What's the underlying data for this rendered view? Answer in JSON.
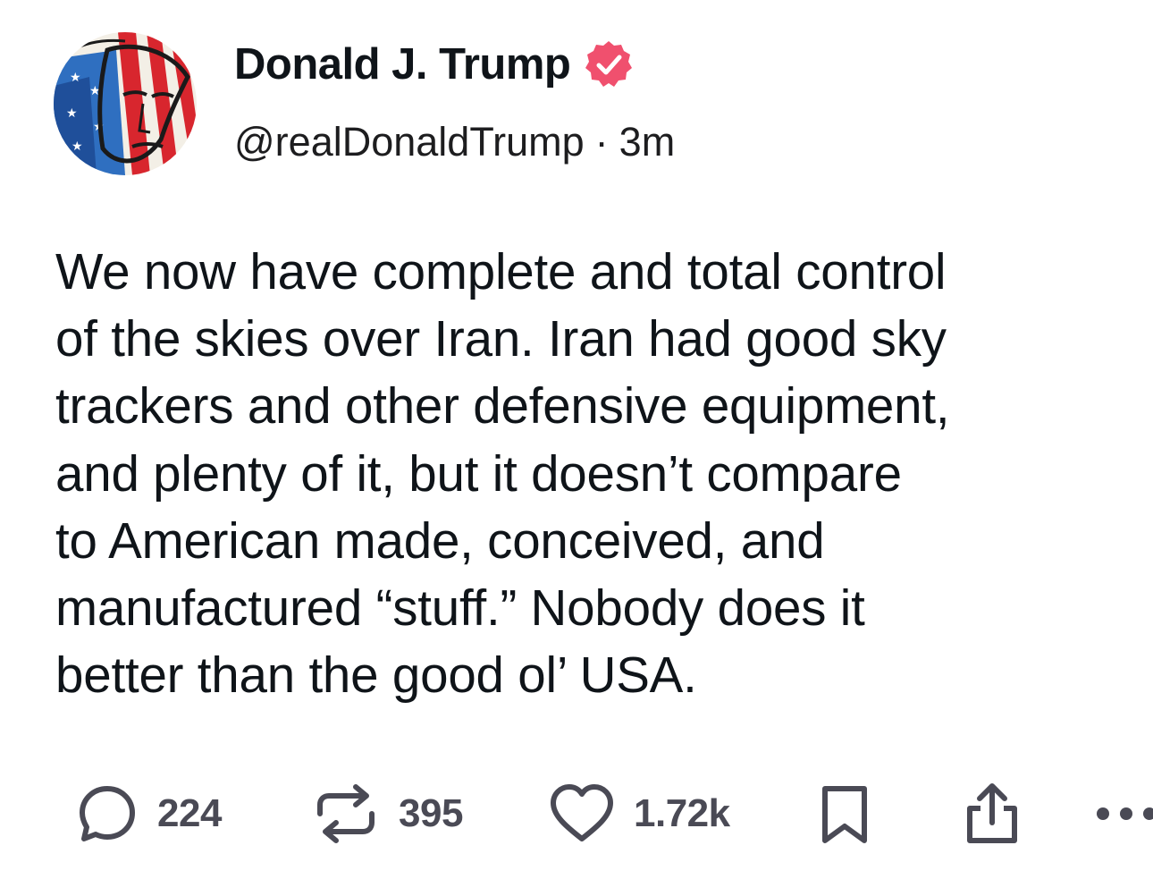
{
  "author": {
    "display_name": "Donald J. Trump",
    "handle": "@realDonaldTrump",
    "separator": "·",
    "timestamp": "3m",
    "verified_color": "#f0506e"
  },
  "post": {
    "text": "We now have complete and total control\nof the skies over Iran. Iran had good sky\ntrackers and other defensive equipment,\nand plenty of it, but it doesn’t compare\nto American made, conceived, and\nmanufactured “stuff.”  Nobody does it\nbetter than the good ol’ USA."
  },
  "actions": {
    "replies": "224",
    "reposts": "395",
    "likes": "1.72k",
    "icons": [
      "reply-icon",
      "repost-icon",
      "heart-icon",
      "bookmark-icon",
      "share-icon",
      "more-icon"
    ],
    "icon_color": "#4a4a55"
  }
}
